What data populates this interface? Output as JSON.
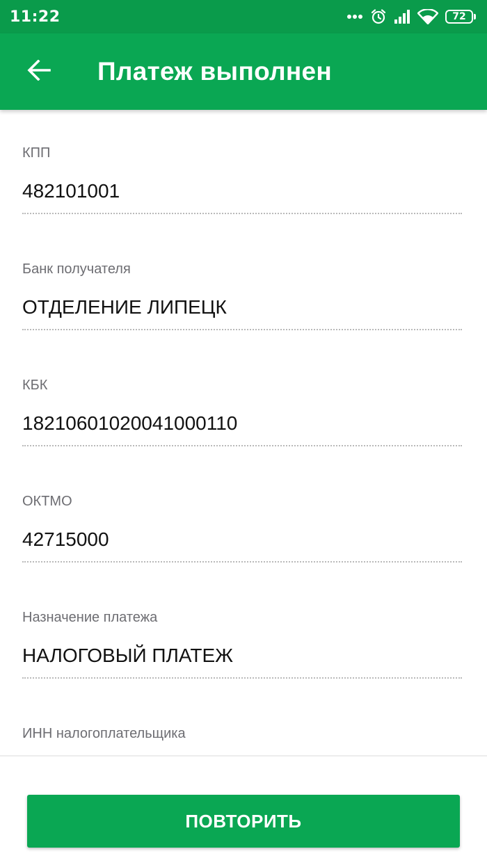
{
  "status_bar": {
    "time": "11:22",
    "battery": "72",
    "icons": [
      "more-dots-icon",
      "alarm-clock-icon",
      "signal-icon",
      "wifi-icon",
      "battery-icon"
    ]
  },
  "app_bar": {
    "back_icon": "arrow-left-icon",
    "title": "Платеж выполнен"
  },
  "fields": [
    {
      "label": "КПП",
      "value": "482101001"
    },
    {
      "label": "Банк получателя",
      "value": "ОТДЕЛЕНИЕ ЛИПЕЦК"
    },
    {
      "label": "КБК",
      "value": "18210601020041000110"
    },
    {
      "label": "ОКТМО",
      "value": "42715000"
    },
    {
      "label": "Назначение платежа",
      "value": "НАЛОГОВЫЙ ПЛАТЕЖ"
    },
    {
      "label": "ИНН налогоплательщика"
    }
  ],
  "footer": {
    "repeat_label": "ПОВТОРИТЬ"
  },
  "colors": {
    "status_bar": "#0a9b4b",
    "app_bar": "#0aa753",
    "button": "#0aa753",
    "label": "#6d6d72",
    "value": "#111111"
  }
}
